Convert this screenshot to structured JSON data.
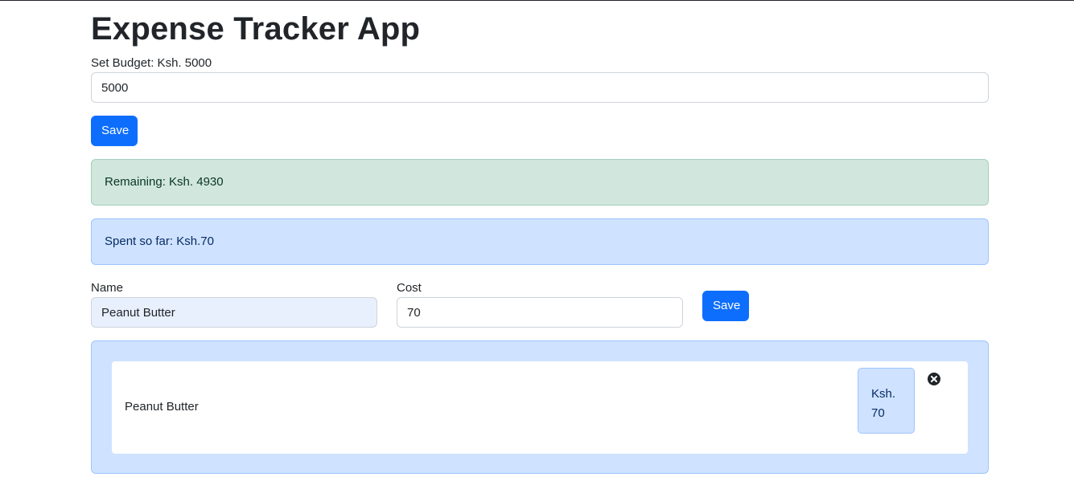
{
  "app": {
    "title": "Expense Tracker App"
  },
  "budget": {
    "label": "Set Budget: Ksh. 5000",
    "input_value": "5000",
    "save_label": "Save"
  },
  "summary": {
    "remaining_text": "Remaining: Ksh. 4930",
    "spent_text": "Spent so far: Ksh.70"
  },
  "expense_form": {
    "name_label": "Name",
    "name_value": "Peanut Butter",
    "cost_label": "Cost",
    "cost_value": "70",
    "save_label": "Save"
  },
  "expenses": [
    {
      "name": "Peanut Butter",
      "cost_currency": "Ksh.",
      "cost_amount": "70"
    }
  ],
  "icons": {
    "delete": "close-circle-icon"
  },
  "colors": {
    "primary": "#0d6efd",
    "success_bg": "#d1e7dd",
    "info_bg": "#cfe2ff"
  }
}
